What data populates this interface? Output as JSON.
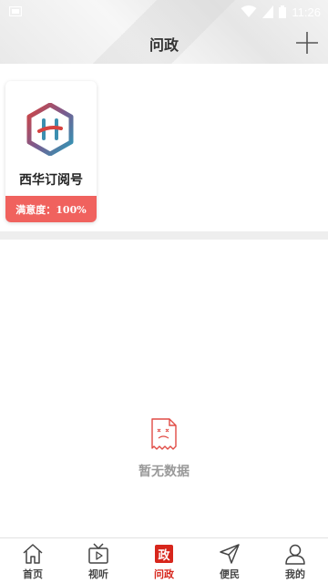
{
  "status_bar": {
    "time": "11:26"
  },
  "header": {
    "title": "问政",
    "add_icon": "plus-icon"
  },
  "card": {
    "name": "西华订阅号",
    "rating": "满意度：100%",
    "logo_letter": "H"
  },
  "empty_state": {
    "icon": "empty-document-icon",
    "text": "暂无数据"
  },
  "bottom_nav": {
    "items": [
      {
        "label": "首页",
        "icon": "home-icon",
        "active": false
      },
      {
        "label": "视听",
        "icon": "tv-icon",
        "active": false
      },
      {
        "label": "问政",
        "icon": "gov-badge-icon",
        "badge": "政",
        "active": true
      },
      {
        "label": "便民",
        "icon": "send-icon",
        "active": false
      },
      {
        "label": "我的",
        "icon": "user-icon",
        "active": false
      }
    ]
  },
  "colors": {
    "accent": "#d7261c",
    "rating_bg": "#f0625e",
    "muted_text": "#999999"
  }
}
